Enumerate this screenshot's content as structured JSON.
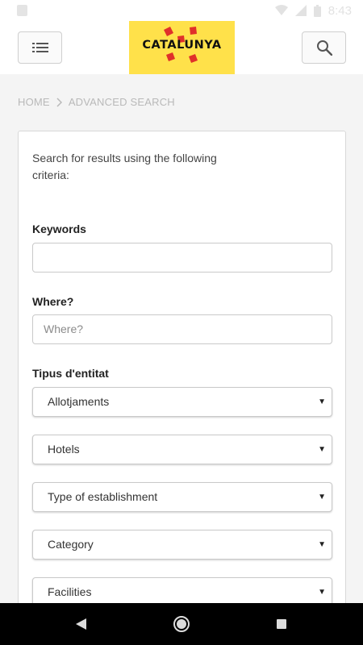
{
  "status": {
    "time": "8:43"
  },
  "header": {
    "logo_text": "CATALUNYA"
  },
  "breadcrumb": {
    "home": "HOME",
    "current": "ADVANCED SEARCH"
  },
  "form": {
    "intro": "Search for results using the following criteria:",
    "keywords_label": "Keywords",
    "keywords_value": "",
    "where_label": "Where?",
    "where_placeholder": "Where?",
    "entity_label": "Tipus d'entitat",
    "selects": [
      "Allotjaments",
      "Hotels",
      "Type of establishment",
      "Category",
      "Facilities"
    ]
  },
  "colors": {
    "brand_yellow": "#ffe14a",
    "brand_red": "#e0302a"
  },
  "icons": [
    "menu-icon",
    "search-icon",
    "chevron-right-icon",
    "dropdown-caret-icon",
    "back-icon",
    "home-icon",
    "recents-icon"
  ]
}
